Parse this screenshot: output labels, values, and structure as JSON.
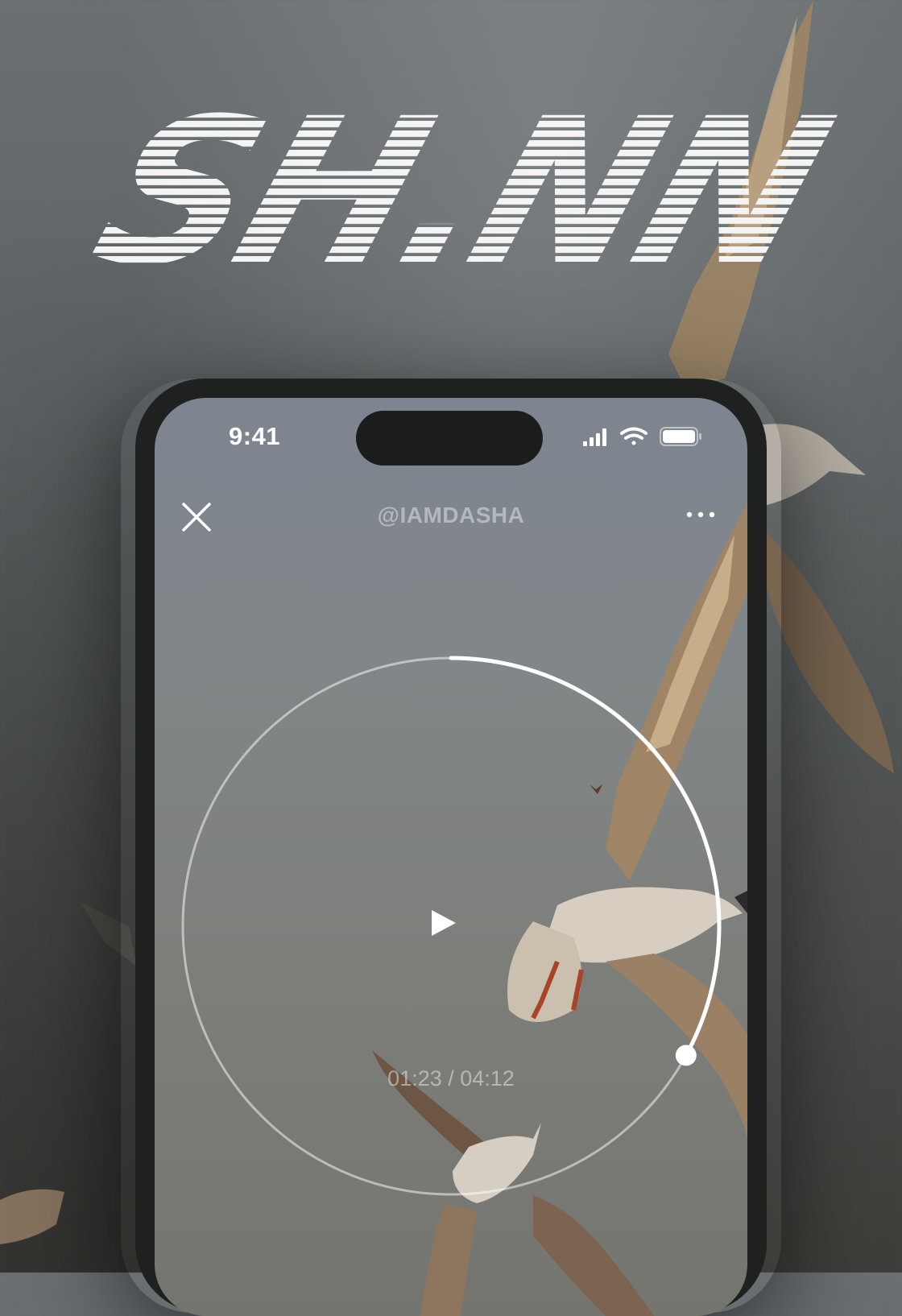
{
  "logo": {
    "text": "SH.NN",
    "icon": "striped-glitch-wordmark"
  },
  "status_bar": {
    "time": "9:41",
    "icons": [
      "cellular-signal-icon",
      "wifi-icon",
      "battery-icon"
    ]
  },
  "header": {
    "username": "@IAMDASHA",
    "close_icon": "close-icon",
    "more_icon": "more-dots-icon"
  },
  "player": {
    "elapsed": "01:23",
    "total": "04:12",
    "timecode": "01:23 / 04:12",
    "progress": 0.33,
    "play_icon": "play-icon"
  },
  "colors": {
    "accent": "#ffffff",
    "phone_frame": "#1f2020",
    "island": "#1c1c1c"
  }
}
